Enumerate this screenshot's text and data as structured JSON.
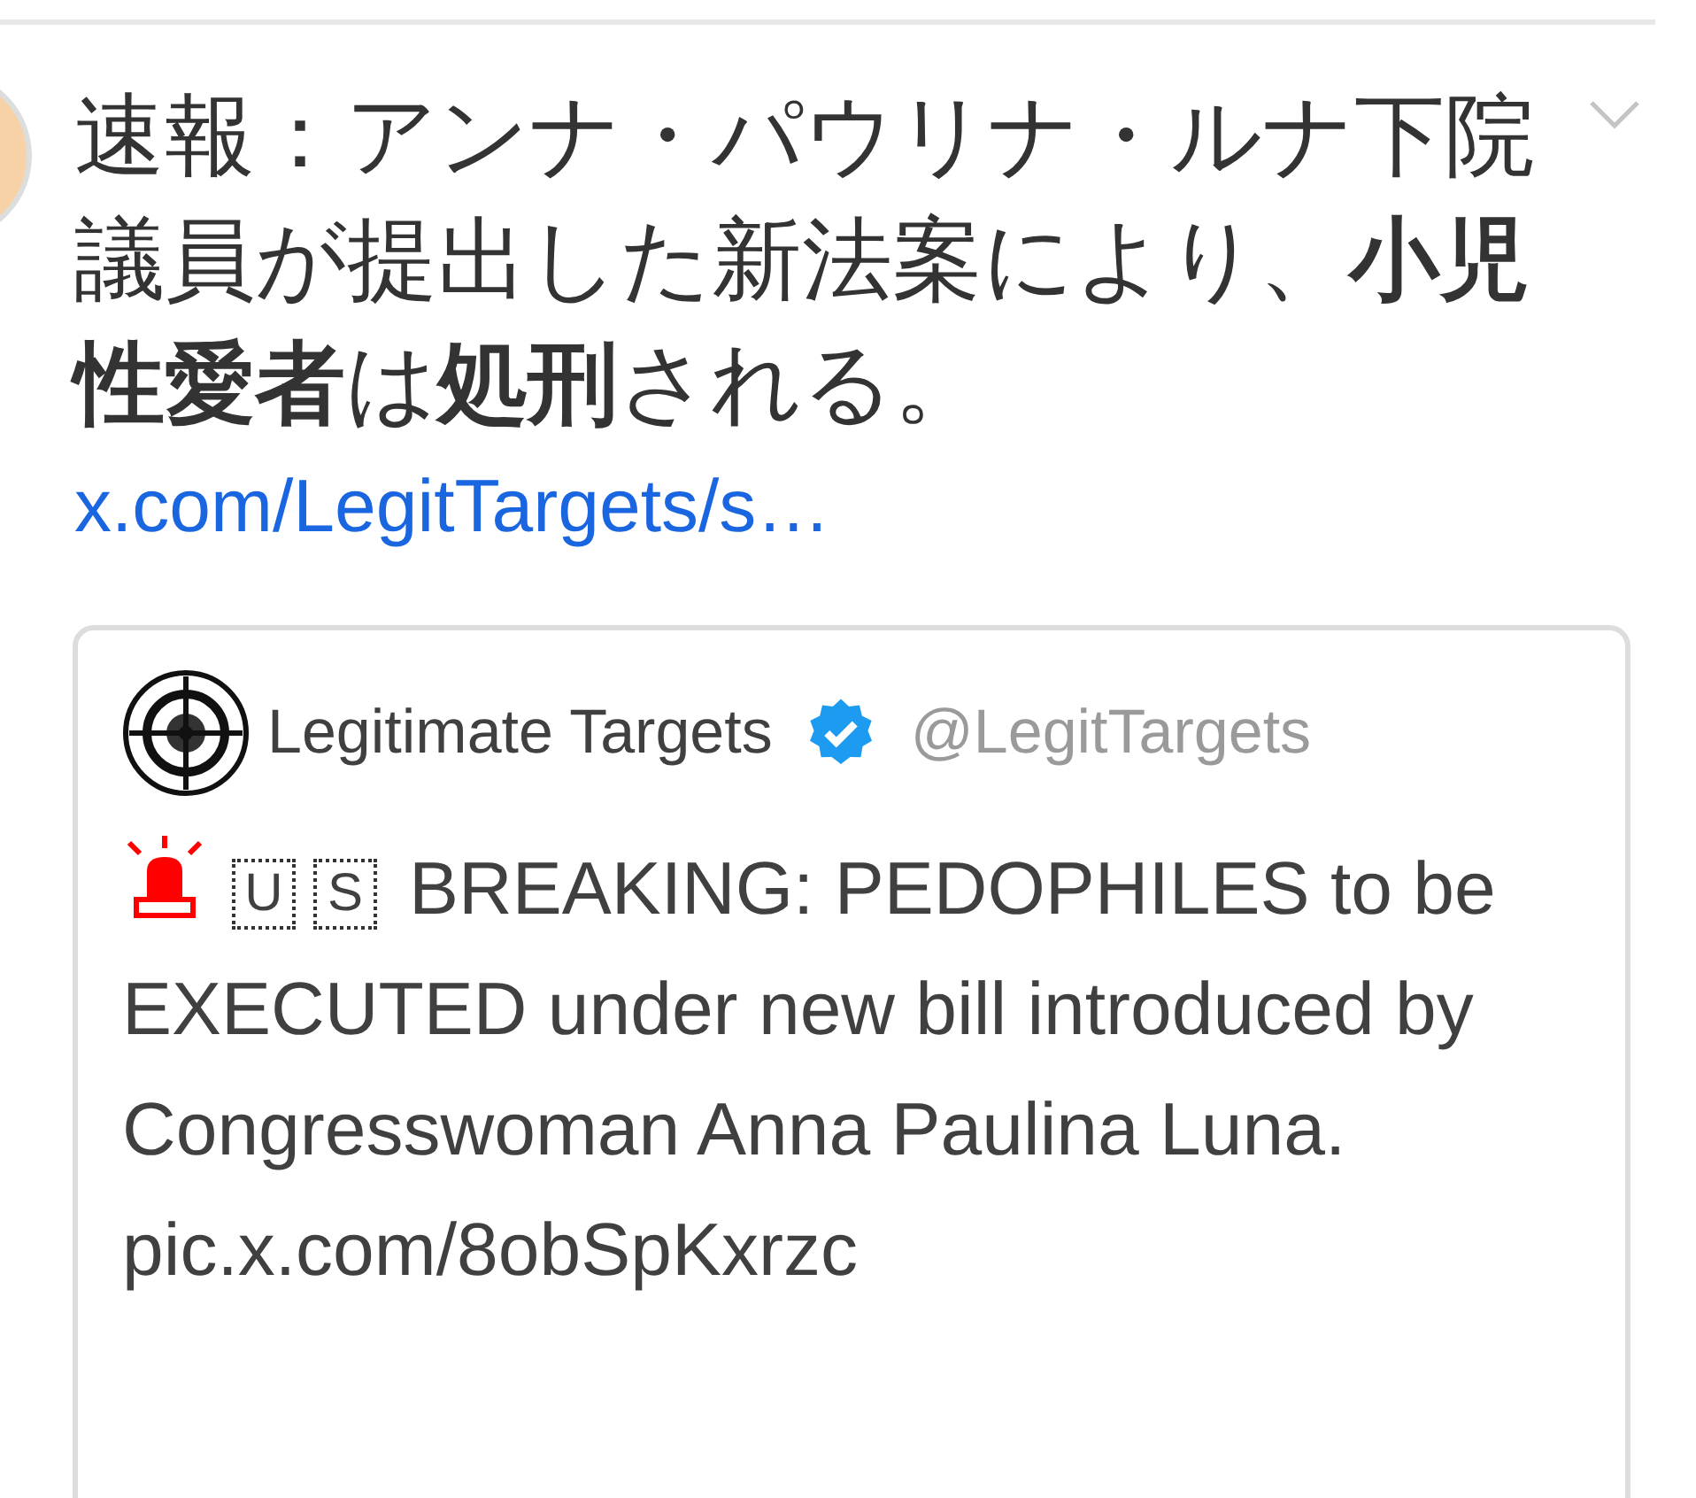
{
  "post": {
    "text": "速報：アンナ・パウリナ・ルナ下院議員が提出した新法案により、**小児性愛者**は**処刑**される。",
    "link": "x.com/LegitTargets/s…",
    "quote": {
      "author": "Legitimate Targets",
      "verified": true,
      "handle": "@LegitTargets",
      "flag": [
        "U",
        "S"
      ],
      "text": "BREAKING: PEDOPHILES to be EXECUTED under new bill introduced by Congresswoman Anna Paulina Luna.",
      "link": "pic.x.com/8obSpKxrzc"
    }
  }
}
